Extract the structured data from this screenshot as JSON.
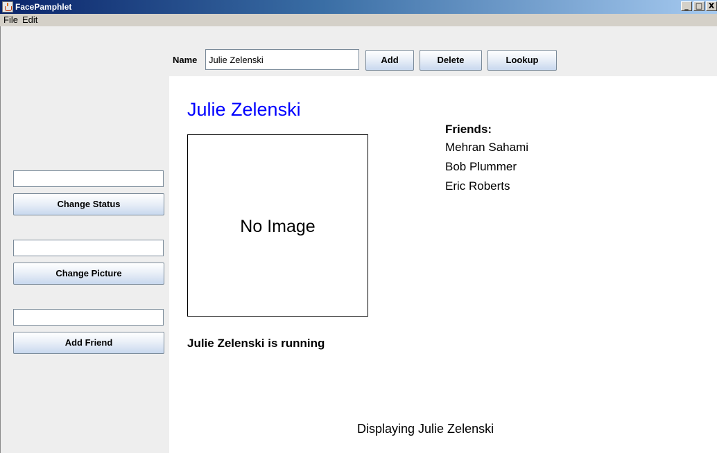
{
  "window": {
    "title": "FacePamphlet",
    "buttons": [
      "_",
      "□",
      "X"
    ]
  },
  "menu": {
    "items": [
      "File",
      "Edit"
    ]
  },
  "toolbar": {
    "name_label": "Name",
    "name_value": "Julie Zelenski",
    "add": "Add",
    "delete": "Delete",
    "lookup": "Lookup"
  },
  "sidebar": {
    "status_field": "",
    "change_status": "Change Status",
    "picture_field": "",
    "change_picture": "Change Picture",
    "friend_field": "",
    "add_friend": "Add Friend"
  },
  "profile": {
    "name": "Julie Zelenski",
    "image_placeholder": "No Image",
    "friends_header": "Friends:",
    "friends": [
      "Mehran Sahami",
      "Bob Plummer",
      "Eric Roberts"
    ],
    "status": "Julie Zelenski is running"
  },
  "message": "Displaying Julie Zelenski",
  "colors": {
    "profile_name": "#0000ff",
    "titlebar": "#0a246a"
  }
}
